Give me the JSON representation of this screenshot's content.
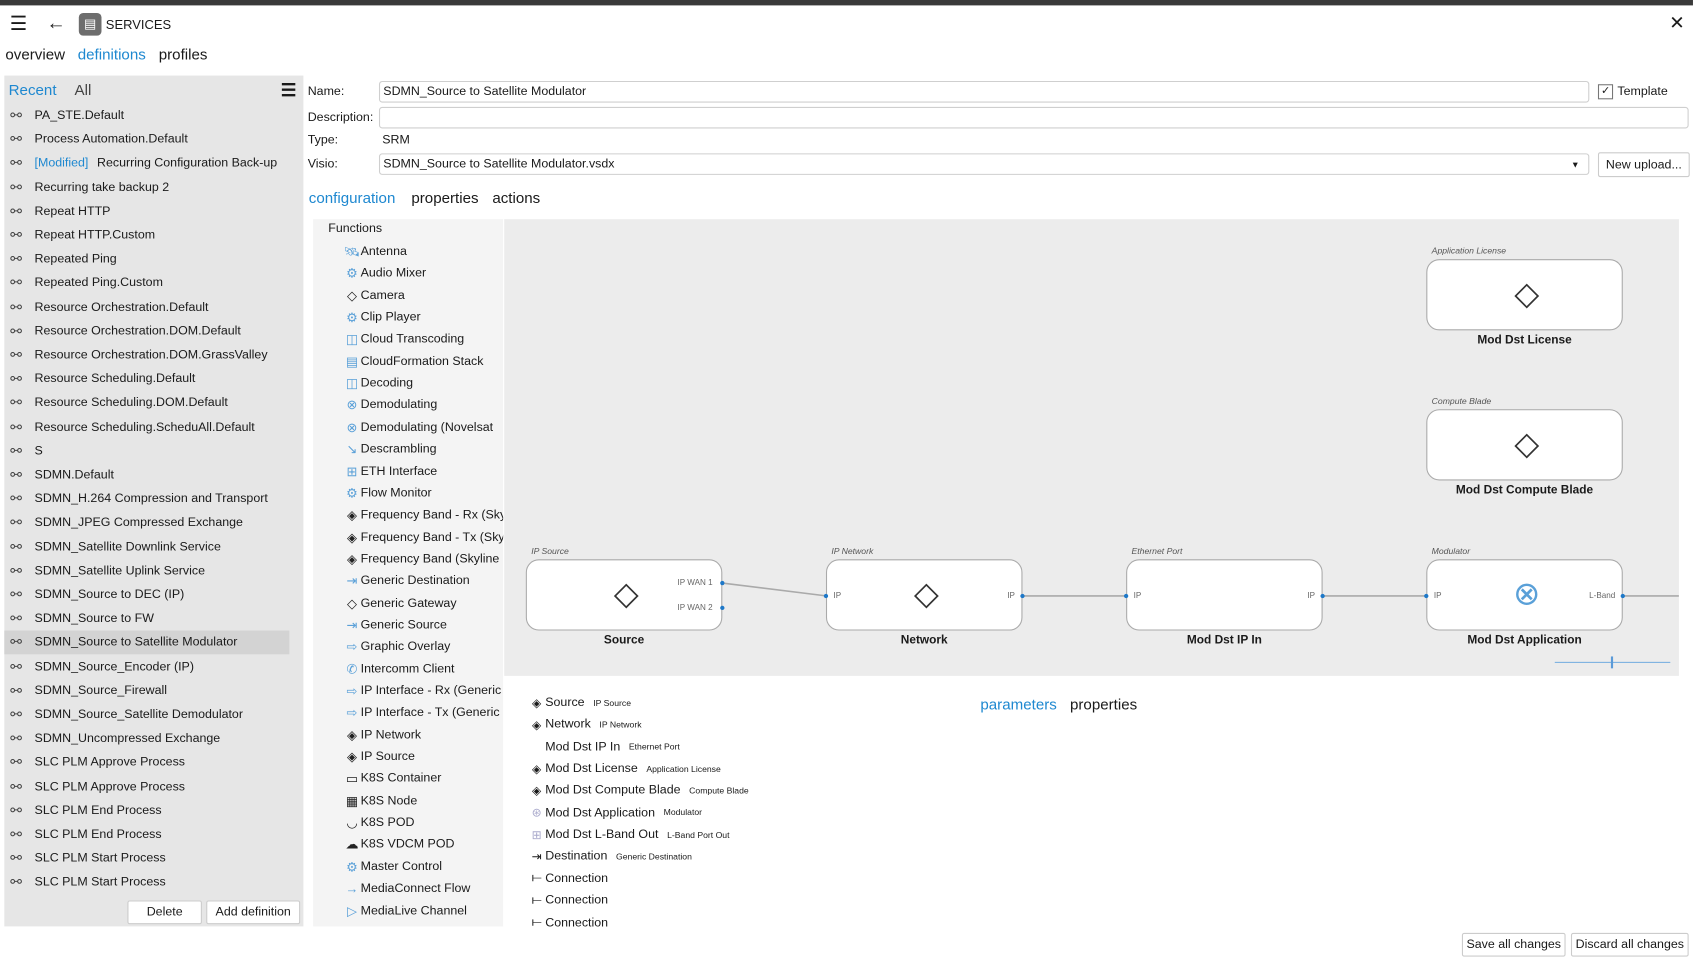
{
  "header": {
    "title": "SERVICES"
  },
  "tabs": [
    {
      "label": "overview"
    },
    {
      "label": "definitions"
    },
    {
      "label": "profiles"
    }
  ],
  "left": {
    "filters": [
      "Recent",
      "All"
    ],
    "modified_tag": "[Modified]",
    "items": [
      "PA_STE.Default",
      "Process Automation.Default",
      "Recurring Configuration Back-up",
      "Recurring take backup 2",
      "Repeat HTTP",
      "Repeat HTTP.Custom",
      "Repeated Ping",
      "Repeated Ping.Custom",
      "Resource Orchestration.Default",
      "Resource Orchestration.DOM.Default",
      "Resource Orchestration.DOM.GrassValley",
      "Resource Scheduling.Default",
      "Resource Scheduling.DOM.Default",
      "Resource Scheduling.ScheduAll.Default",
      "S",
      "SDMN.Default",
      "SDMN_H.264 Compression and Transport",
      "SDMN_JPEG Compressed Exchange",
      "SDMN_Satellite Downlink Service",
      "SDMN_Satellite Uplink Service",
      "SDMN_Source to DEC (IP)",
      "SDMN_Source to FW",
      "SDMN_Source to Satellite Modulator",
      "SDMN_Source_Encoder (IP)",
      "SDMN_Source_Firewall",
      "SDMN_Source_Satellite Demodulator",
      "SDMN_Uncompressed Exchange",
      "SLC PLM Approve Process",
      "SLC PLM Approve Process",
      "SLC PLM End Process",
      "SLC PLM End Process",
      "SLC PLM Start Process",
      "SLC PLM Start Process"
    ],
    "delete": "Delete",
    "add": "Add definition"
  },
  "form": {
    "name_label": "Name:",
    "name": "SDMN_Source to Satellite Modulator",
    "template_label": "Template",
    "template_checked": true,
    "description_label": "Description:",
    "description": "",
    "type_label": "Type:",
    "type": "SRM",
    "visio_label": "Visio:",
    "visio": "SDMN_Source to Satellite Modulator.vsdx",
    "new_upload": "New upload..."
  },
  "subtabs": [
    "configuration",
    "properties",
    "actions"
  ],
  "functions": {
    "title": "Functions",
    "items": [
      "Antenna",
      "Audio Mixer",
      "Camera",
      "Clip Player",
      "Cloud Transcoding",
      "CloudFormation Stack",
      "Decoding",
      "Demodulating",
      "Demodulating (Novelsat",
      "Descrambling",
      "ETH Interface",
      "Flow Monitor",
      "Frequency Band - Rx (Sky",
      "Frequency Band - Tx (Sky",
      "Frequency Band (Skyline",
      "Generic Destination",
      "Generic Gateway",
      "Generic Source",
      "Graphic Overlay",
      "Intercomm Client",
      "IP Interface - Rx (Generic",
      "IP Interface - Tx (Generic",
      "IP Network",
      "IP Source",
      "K8S Container",
      "K8S Node",
      "K8S POD",
      "K8S VDCM POD",
      "Master Control",
      "MediaConnect Flow",
      "MediaLive Channel"
    ]
  },
  "diagram": {
    "nodes": [
      {
        "type": "IP Source",
        "name": "Source",
        "ports": [
          "IP WAN 1",
          "IP WAN 2"
        ]
      },
      {
        "type": "IP Network",
        "name": "Network",
        "ports": [
          "IP",
          "IP"
        ]
      },
      {
        "type": "Ethernet Port",
        "name": "Mod Dst IP In",
        "ports": [
          "IP",
          "IP"
        ]
      },
      {
        "type": "Modulator",
        "name": "Mod Dst Application",
        "ports": [
          "IP",
          "L-Band"
        ]
      },
      {
        "type": "Application License",
        "name": "Mod Dst License"
      },
      {
        "type": "Compute Blade",
        "name": "Mod Dst Compute Blade"
      }
    ],
    "zoom_level": 0.5
  },
  "bottom": {
    "items": [
      {
        "name": "Source",
        "type": "IP Source"
      },
      {
        "name": "Network",
        "type": "IP Network"
      },
      {
        "name": "Mod Dst IP In",
        "type": "Ethernet Port"
      },
      {
        "name": "Mod Dst License",
        "type": "Application License"
      },
      {
        "name": "Mod Dst Compute Blade",
        "type": "Compute Blade"
      },
      {
        "name": "Mod Dst Application",
        "type": "Modulator"
      },
      {
        "name": "Mod Dst L-Band Out",
        "type": "L-Band Port Out"
      },
      {
        "name": "Destination",
        "type": "Generic Destination"
      },
      {
        "name": "Connection",
        "type": ""
      },
      {
        "name": "Connection",
        "type": ""
      },
      {
        "name": "Connection",
        "type": ""
      }
    ],
    "tabs": [
      "parameters",
      "properties"
    ]
  },
  "footer": {
    "save": "Save all changes",
    "discard": "Discard all changes"
  }
}
